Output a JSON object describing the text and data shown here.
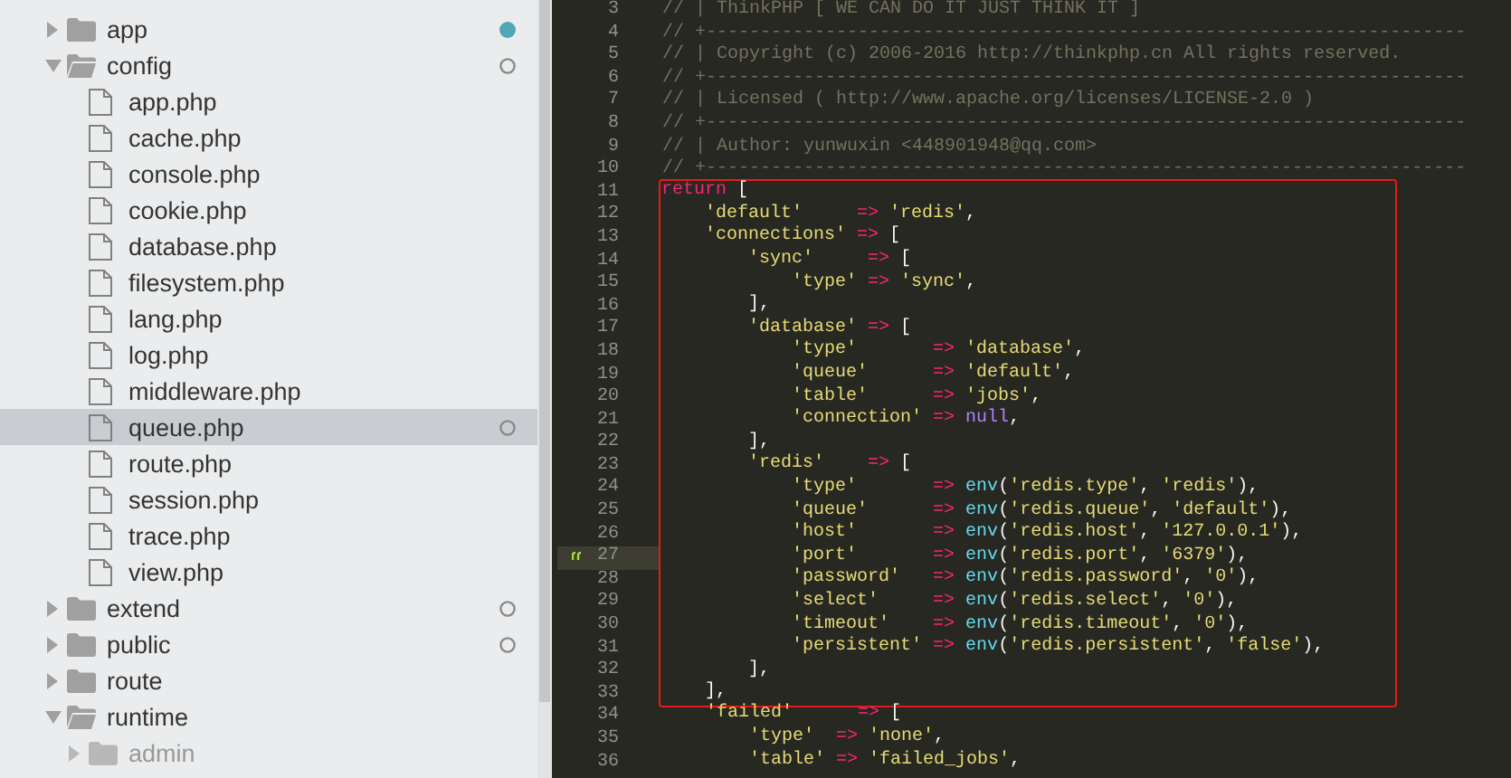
{
  "sidebar": {
    "items": [
      {
        "label": "app",
        "kind": "folder",
        "expanded": false,
        "selected": false,
        "dimmed": false,
        "status_dot": {
          "kind": "filled"
        }
      },
      {
        "label": "config",
        "kind": "folder",
        "expanded": true,
        "selected": false,
        "dimmed": false,
        "status_dot": {
          "kind": "hollow"
        },
        "children": [
          {
            "label": "app.php",
            "kind": "file",
            "selected": false,
            "dimmed": false
          },
          {
            "label": "cache.php",
            "kind": "file",
            "selected": false,
            "dimmed": false
          },
          {
            "label": "console.php",
            "kind": "file",
            "selected": false,
            "dimmed": false
          },
          {
            "label": "cookie.php",
            "kind": "file",
            "selected": false,
            "dimmed": false
          },
          {
            "label": "database.php",
            "kind": "file",
            "selected": false,
            "dimmed": false
          },
          {
            "label": "filesystem.php",
            "kind": "file",
            "selected": false,
            "dimmed": false
          },
          {
            "label": "lang.php",
            "kind": "file",
            "selected": false,
            "dimmed": false
          },
          {
            "label": "log.php",
            "kind": "file",
            "selected": false,
            "dimmed": false
          },
          {
            "label": "middleware.php",
            "kind": "file",
            "selected": false,
            "dimmed": false
          },
          {
            "label": "queue.php",
            "kind": "file",
            "selected": true,
            "dimmed": false,
            "status_dot": {
              "kind": "hollow"
            }
          },
          {
            "label": "route.php",
            "kind": "file",
            "selected": false,
            "dimmed": false
          },
          {
            "label": "session.php",
            "kind": "file",
            "selected": false,
            "dimmed": false
          },
          {
            "label": "trace.php",
            "kind": "file",
            "selected": false,
            "dimmed": false
          },
          {
            "label": "view.php",
            "kind": "file",
            "selected": false,
            "dimmed": false
          }
        ]
      },
      {
        "label": "extend",
        "kind": "folder",
        "expanded": false,
        "selected": false,
        "dimmed": false,
        "status_dot": {
          "kind": "hollow"
        }
      },
      {
        "label": "public",
        "kind": "folder",
        "expanded": false,
        "selected": false,
        "dimmed": false,
        "status_dot": {
          "kind": "hollow"
        }
      },
      {
        "label": "route",
        "kind": "folder",
        "expanded": false,
        "selected": false,
        "dimmed": false
      },
      {
        "label": "runtime",
        "kind": "folder",
        "expanded": true,
        "selected": false,
        "dimmed": false,
        "children": [
          {
            "label": "admin",
            "kind": "folder",
            "expanded": false,
            "selected": false,
            "dimmed": true
          }
        ]
      }
    ]
  },
  "editor": {
    "lines": [
      {
        "number": "3",
        "current": false,
        "boxed": false,
        "tokens": [
          {
            "kind": "comment",
            "text": "// | ThinkPHP [ WE CAN DO IT JUST THINK IT ]"
          }
        ]
      },
      {
        "number": "4",
        "current": false,
        "boxed": false,
        "tokens": [
          {
            "kind": "comment",
            "text": "// +----------------------------------------------------------------------"
          }
        ]
      },
      {
        "number": "5",
        "current": false,
        "boxed": false,
        "tokens": [
          {
            "kind": "comment",
            "text": "// | Copyright (c) 2006-2016 http://thinkphp.cn All rights reserved."
          }
        ]
      },
      {
        "number": "6",
        "current": false,
        "boxed": false,
        "tokens": [
          {
            "kind": "comment",
            "text": "// +----------------------------------------------------------------------"
          }
        ]
      },
      {
        "number": "7",
        "current": false,
        "boxed": false,
        "tokens": [
          {
            "kind": "comment",
            "text": "// | Licensed ( http://www.apache.org/licenses/LICENSE-2.0 )"
          }
        ]
      },
      {
        "number": "8",
        "current": false,
        "boxed": false,
        "tokens": [
          {
            "kind": "comment",
            "text": "// +----------------------------------------------------------------------"
          }
        ]
      },
      {
        "number": "9",
        "current": false,
        "boxed": false,
        "tokens": [
          {
            "kind": "comment",
            "text": "// | Author: yunwuxin <448901948@qq.com>"
          }
        ]
      },
      {
        "number": "10",
        "current": false,
        "boxed": false,
        "tokens": [
          {
            "kind": "comment",
            "text": "// +----------------------------------------------------------------------"
          }
        ]
      },
      {
        "number": "11",
        "current": false,
        "boxed": true,
        "tokens": [
          {
            "kind": "keyword",
            "text": "return"
          },
          {
            "kind": "plain",
            "text": " ["
          }
        ]
      },
      {
        "number": "12",
        "current": false,
        "boxed": true,
        "tokens": [
          {
            "kind": "string",
            "text": "    'default'"
          },
          {
            "kind": "operator",
            "text": "     =>"
          },
          {
            "kind": "string",
            "text": " 'redis'"
          },
          {
            "kind": "plain",
            "text": ","
          }
        ]
      },
      {
        "number": "13",
        "current": false,
        "boxed": true,
        "tokens": [
          {
            "kind": "string",
            "text": "    'connections'"
          },
          {
            "kind": "operator",
            "text": " =>"
          },
          {
            "kind": "plain",
            "text": " ["
          }
        ]
      },
      {
        "number": "14",
        "current": false,
        "boxed": true,
        "tokens": [
          {
            "kind": "string",
            "text": "        'sync'"
          },
          {
            "kind": "operator",
            "text": "     =>"
          },
          {
            "kind": "plain",
            "text": " ["
          }
        ]
      },
      {
        "number": "15",
        "current": false,
        "boxed": true,
        "tokens": [
          {
            "kind": "string",
            "text": "            'type'"
          },
          {
            "kind": "operator",
            "text": " =>"
          },
          {
            "kind": "string",
            "text": " 'sync'"
          },
          {
            "kind": "plain",
            "text": ","
          }
        ]
      },
      {
        "number": "16",
        "current": false,
        "boxed": true,
        "tokens": [
          {
            "kind": "plain",
            "text": "        ],"
          }
        ]
      },
      {
        "number": "17",
        "current": false,
        "boxed": true,
        "tokens": [
          {
            "kind": "string",
            "text": "        'database'"
          },
          {
            "kind": "operator",
            "text": " =>"
          },
          {
            "kind": "plain",
            "text": " ["
          }
        ]
      },
      {
        "number": "18",
        "current": false,
        "boxed": true,
        "tokens": [
          {
            "kind": "string",
            "text": "            'type'"
          },
          {
            "kind": "operator",
            "text": "       =>"
          },
          {
            "kind": "string",
            "text": " 'database'"
          },
          {
            "kind": "plain",
            "text": ","
          }
        ]
      },
      {
        "number": "19",
        "current": false,
        "boxed": true,
        "tokens": [
          {
            "kind": "string",
            "text": "            'queue'"
          },
          {
            "kind": "operator",
            "text": "      =>"
          },
          {
            "kind": "string",
            "text": " 'default'"
          },
          {
            "kind": "plain",
            "text": ","
          }
        ]
      },
      {
        "number": "20",
        "current": false,
        "boxed": true,
        "tokens": [
          {
            "kind": "string",
            "text": "            'table'"
          },
          {
            "kind": "operator",
            "text": "      =>"
          },
          {
            "kind": "string",
            "text": " 'jobs'"
          },
          {
            "kind": "plain",
            "text": ","
          }
        ]
      },
      {
        "number": "21",
        "current": false,
        "boxed": true,
        "tokens": [
          {
            "kind": "string",
            "text": "            'connection'"
          },
          {
            "kind": "operator",
            "text": " =>"
          },
          {
            "kind": "constant",
            "text": " null"
          },
          {
            "kind": "plain",
            "text": ","
          }
        ]
      },
      {
        "number": "22",
        "current": false,
        "boxed": true,
        "tokens": [
          {
            "kind": "plain",
            "text": "        ],"
          }
        ]
      },
      {
        "number": "23",
        "current": false,
        "boxed": true,
        "tokens": [
          {
            "kind": "string",
            "text": "        'redis'"
          },
          {
            "kind": "operator",
            "text": "    =>"
          },
          {
            "kind": "plain",
            "text": " ["
          }
        ]
      },
      {
        "number": "24",
        "current": false,
        "boxed": true,
        "tokens": [
          {
            "kind": "string",
            "text": "            'type'"
          },
          {
            "kind": "operator",
            "text": "       =>"
          },
          {
            "kind": "function",
            "text": " env"
          },
          {
            "kind": "plain",
            "text": "("
          },
          {
            "kind": "string",
            "text": "'redis.type'"
          },
          {
            "kind": "plain",
            "text": ","
          },
          {
            "kind": "string",
            "text": " 'redis'"
          },
          {
            "kind": "plain",
            "text": "),"
          }
        ]
      },
      {
        "number": "25",
        "current": false,
        "boxed": true,
        "tokens": [
          {
            "kind": "string",
            "text": "            'queue'"
          },
          {
            "kind": "operator",
            "text": "      =>"
          },
          {
            "kind": "function",
            "text": " env"
          },
          {
            "kind": "plain",
            "text": "("
          },
          {
            "kind": "string",
            "text": "'redis.queue'"
          },
          {
            "kind": "plain",
            "text": ","
          },
          {
            "kind": "string",
            "text": " 'default'"
          },
          {
            "kind": "plain",
            "text": "),"
          }
        ]
      },
      {
        "number": "26",
        "current": false,
        "boxed": true,
        "tokens": [
          {
            "kind": "string",
            "text": "            'host'"
          },
          {
            "kind": "operator",
            "text": "       =>"
          },
          {
            "kind": "function",
            "text": " env"
          },
          {
            "kind": "plain",
            "text": "("
          },
          {
            "kind": "string",
            "text": "'redis.host'"
          },
          {
            "kind": "plain",
            "text": ","
          },
          {
            "kind": "string",
            "text": " '127.0.0.1'"
          },
          {
            "kind": "plain",
            "text": "),"
          }
        ]
      },
      {
        "number": "27",
        "current": true,
        "boxed": true,
        "tokens": [
          {
            "kind": "string",
            "text": "            'port'"
          },
          {
            "kind": "operator",
            "text": "       =>"
          },
          {
            "kind": "function",
            "text": " env"
          },
          {
            "kind": "plain",
            "text": "("
          },
          {
            "kind": "string",
            "text": "'redis.port'"
          },
          {
            "kind": "plain",
            "text": ","
          },
          {
            "kind": "string",
            "text": " '6379'"
          },
          {
            "kind": "plain",
            "text": "),"
          }
        ]
      },
      {
        "number": "28",
        "current": false,
        "boxed": true,
        "tokens": [
          {
            "kind": "string",
            "text": "            'password'"
          },
          {
            "kind": "operator",
            "text": "   =>"
          },
          {
            "kind": "function",
            "text": " env"
          },
          {
            "kind": "plain",
            "text": "("
          },
          {
            "kind": "string",
            "text": "'redis.password'"
          },
          {
            "kind": "plain",
            "text": ","
          },
          {
            "kind": "string",
            "text": " '0'"
          },
          {
            "kind": "plain",
            "text": "),"
          }
        ]
      },
      {
        "number": "29",
        "current": false,
        "boxed": true,
        "tokens": [
          {
            "kind": "string",
            "text": "            'select'"
          },
          {
            "kind": "operator",
            "text": "     =>"
          },
          {
            "kind": "function",
            "text": " env"
          },
          {
            "kind": "plain",
            "text": "("
          },
          {
            "kind": "string",
            "text": "'redis.select'"
          },
          {
            "kind": "plain",
            "text": ","
          },
          {
            "kind": "string",
            "text": " '0'"
          },
          {
            "kind": "plain",
            "text": "),"
          }
        ]
      },
      {
        "number": "30",
        "current": false,
        "boxed": true,
        "tokens": [
          {
            "kind": "string",
            "text": "            'timeout'"
          },
          {
            "kind": "operator",
            "text": "    =>"
          },
          {
            "kind": "function",
            "text": " env"
          },
          {
            "kind": "plain",
            "text": "("
          },
          {
            "kind": "string",
            "text": "'redis.timeout'"
          },
          {
            "kind": "plain",
            "text": ","
          },
          {
            "kind": "string",
            "text": " '0'"
          },
          {
            "kind": "plain",
            "text": "),"
          }
        ]
      },
      {
        "number": "31",
        "current": false,
        "boxed": true,
        "tokens": [
          {
            "kind": "string",
            "text": "            'persistent'"
          },
          {
            "kind": "operator",
            "text": " =>"
          },
          {
            "kind": "function",
            "text": " env"
          },
          {
            "kind": "plain",
            "text": "("
          },
          {
            "kind": "string",
            "text": "'redis.persistent'"
          },
          {
            "kind": "plain",
            "text": ","
          },
          {
            "kind": "string",
            "text": " 'false'"
          },
          {
            "kind": "plain",
            "text": "),"
          }
        ]
      },
      {
        "number": "32",
        "current": false,
        "boxed": true,
        "tokens": [
          {
            "kind": "plain",
            "text": "        ],"
          }
        ]
      },
      {
        "number": "33",
        "current": false,
        "boxed": true,
        "tokens": [
          {
            "kind": "plain",
            "text": "    ],"
          }
        ]
      },
      {
        "number": "34",
        "current": false,
        "boxed": false,
        "tokens": [
          {
            "kind": "string",
            "text": "    'failed'"
          },
          {
            "kind": "operator",
            "text": "      =>"
          },
          {
            "kind": "plain",
            "text": " ["
          }
        ]
      },
      {
        "number": "35",
        "current": false,
        "boxed": false,
        "tokens": [
          {
            "kind": "string",
            "text": "        'type'"
          },
          {
            "kind": "operator",
            "text": "  =>"
          },
          {
            "kind": "string",
            "text": " 'none'"
          },
          {
            "kind": "plain",
            "text": ","
          }
        ]
      },
      {
        "number": "36",
        "current": false,
        "boxed": false,
        "tokens": [
          {
            "kind": "string",
            "text": "        'table'"
          },
          {
            "kind": "operator",
            "text": " =>"
          },
          {
            "kind": "string",
            "text": " 'failed_jobs'"
          },
          {
            "kind": "plain",
            "text": ","
          }
        ]
      }
    ]
  }
}
